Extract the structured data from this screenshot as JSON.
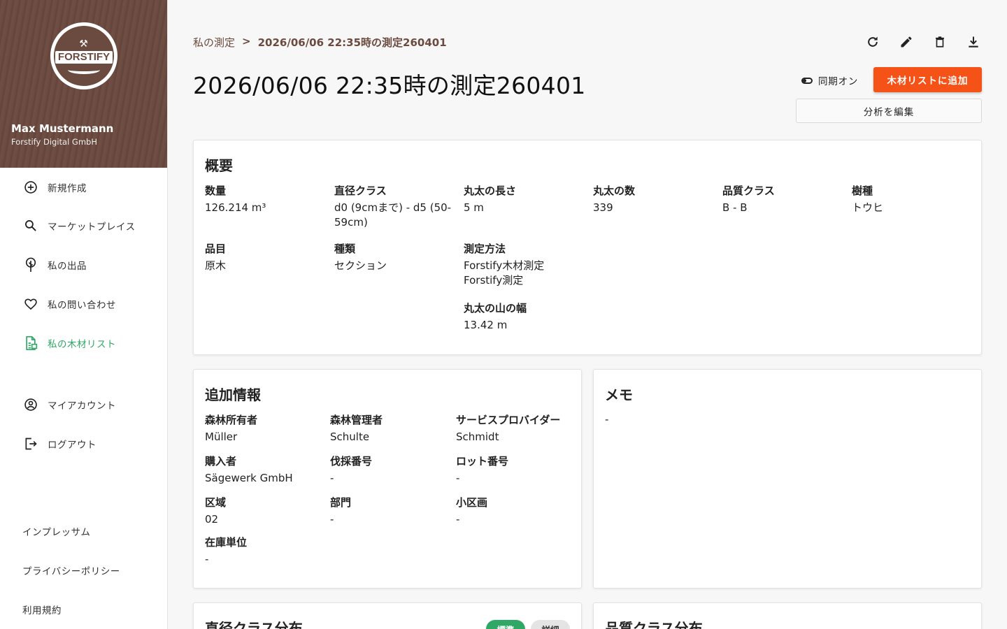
{
  "sidebar": {
    "logo_text": "FORSTIFY",
    "user_name": "Max Mustermann",
    "company": "Forstify Digital GmbH",
    "nav": [
      {
        "label": "新規作成",
        "icon": "add-circle-icon"
      },
      {
        "label": "マーケットプレイス",
        "icon": "search-icon"
      },
      {
        "label": "私の出品",
        "icon": "tree-icon"
      },
      {
        "label": "私の問い合わせ",
        "icon": "heart-icon"
      },
      {
        "label": "私の木材リスト",
        "icon": "document-list-icon",
        "active": true
      }
    ],
    "account": [
      {
        "label": "マイアカウント",
        "icon": "account-circle-icon"
      },
      {
        "label": "ログアウト",
        "icon": "logout-icon"
      }
    ],
    "footer": [
      "インプレッサム",
      "プライバシーポリシー",
      "利用規約"
    ],
    "accent_color": "#2fa866",
    "header_color": "#6b4a3f"
  },
  "breadcrumb": {
    "parent": "私の測定",
    "separator": ">",
    "current": "2026/06/06 22:35時の測定260401"
  },
  "title": "2026/06/06 22:35時の測定260401",
  "toolbar": [
    "refresh-icon",
    "edit-icon",
    "delete-icon",
    "download-icon"
  ],
  "sync_label": "同期オン",
  "add_button": "木材リストに追加",
  "edit_button": "分析を編集",
  "primary_color": "#f55217",
  "overview": {
    "title": "概要",
    "fields": [
      {
        "label": "数量",
        "value": "126.214 m³"
      },
      {
        "label": "直径クラス",
        "value": "d0 (9cmまで) - d5 (50-59cm)"
      },
      {
        "label": "丸太の長さ",
        "value": "5 m"
      },
      {
        "label": "丸太の数",
        "value": "339"
      },
      {
        "label": "品質クラス",
        "value": "B - B"
      },
      {
        "label": "樹種",
        "value": "トウヒ"
      },
      {
        "label": "品目",
        "value": "原木"
      },
      {
        "label": "種類",
        "value": "セクション"
      },
      {
        "label": "測定方法",
        "value": "Forstify木材測定 Forstify測定"
      },
      {
        "label": "丸太の山の幅",
        "value": "13.42 m"
      }
    ]
  },
  "additional": {
    "title": "追加情報",
    "fields": [
      {
        "label": "森林所有者",
        "value": "Müller"
      },
      {
        "label": "森林管理者",
        "value": "Schulte"
      },
      {
        "label": "サービスプロバイダー",
        "value": "Schmidt"
      },
      {
        "label": "購入者",
        "value": "Sägewerk GmbH"
      },
      {
        "label": "伐採番号",
        "value": "-"
      },
      {
        "label": "ロット番号",
        "value": "-"
      },
      {
        "label": "区域",
        "value": "02"
      },
      {
        "label": "部門",
        "value": "-"
      },
      {
        "label": "小区画",
        "value": "-"
      },
      {
        "label": "在庫単位",
        "value": "-"
      }
    ]
  },
  "memo": {
    "title": "メモ",
    "value": "-"
  },
  "diameter_dist": {
    "title": "直径クラス分布",
    "chips": [
      "標準",
      "詳細"
    ]
  },
  "quality_dist": {
    "title": "品質クラス分布"
  }
}
